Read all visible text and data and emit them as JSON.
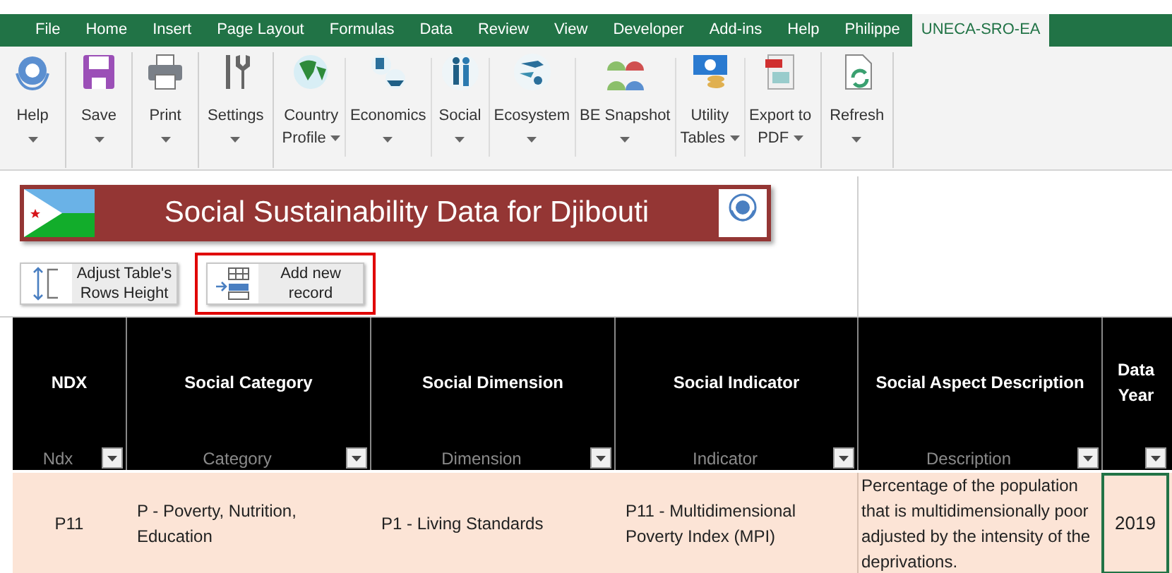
{
  "ribbon_tabs": [
    {
      "label": "File",
      "selected": false
    },
    {
      "label": "Home",
      "selected": false
    },
    {
      "label": "Insert",
      "selected": false
    },
    {
      "label": "Page Layout",
      "selected": false
    },
    {
      "label": "Formulas",
      "selected": false
    },
    {
      "label": "Data",
      "selected": false
    },
    {
      "label": "Review",
      "selected": false
    },
    {
      "label": "View",
      "selected": false
    },
    {
      "label": "Developer",
      "selected": false
    },
    {
      "label": "Add-ins",
      "selected": false
    },
    {
      "label": "Help",
      "selected": false
    },
    {
      "label": "Philippe",
      "selected": false
    },
    {
      "label": "UNECA-SRO-EA",
      "selected": true
    }
  ],
  "ribbon_groups": [
    [
      {
        "lines": [
          "Help"
        ],
        "dropdown": true
      }
    ],
    [
      {
        "lines": [
          "Save"
        ],
        "dropdown": true
      }
    ],
    [
      {
        "lines": [
          "Print"
        ],
        "dropdown": true
      }
    ],
    [
      {
        "lines": [
          "Settings"
        ],
        "dropdown": true
      }
    ],
    [
      {
        "lines": [
          "Country",
          "Profile"
        ],
        "dropdown": true
      },
      {
        "lines": [
          "Economics"
        ],
        "dropdown": true
      },
      {
        "lines": [
          "Social"
        ],
        "dropdown": true
      },
      {
        "lines": [
          "Ecosystem"
        ],
        "dropdown": true
      },
      {
        "lines": [
          "BE Snapshot"
        ],
        "dropdown": true
      },
      {
        "lines": [
          "Utility",
          "Tables"
        ],
        "dropdown": true
      },
      {
        "lines": [
          "Export to",
          "PDF"
        ],
        "dropdown": true
      }
    ],
    [
      {
        "lines": [
          "Refresh"
        ],
        "dropdown": true
      }
    ]
  ],
  "banner": {
    "title": "Social Sustainability Data for Djibouti"
  },
  "sheet_buttons": [
    {
      "label": "Adjust Table's Rows Height",
      "highlighted": false
    },
    {
      "label": "Add new record",
      "highlighted": true
    }
  ],
  "table": {
    "columns": [
      {
        "title": "NDX",
        "filter_label": "Ndx"
      },
      {
        "title": "Social Category",
        "filter_label": "Category"
      },
      {
        "title": "Social Dimension",
        "filter_label": "Dimension"
      },
      {
        "title": "Social Indicator",
        "filter_label": "Indicator"
      },
      {
        "title": "Social Aspect Description",
        "filter_label": "Description"
      },
      {
        "title": "Data Year"
      }
    ],
    "rows": [
      [
        {
          "text": "P11",
          "active": false
        },
        {
          "text": "P - Poverty, Nutrition, Education",
          "active": false
        },
        {
          "text": "P1 - Living Standards",
          "active": false
        },
        {
          "text": "P11 - Multidimensional Poverty Index (MPI)",
          "active": false
        },
        {
          "text": "Percentage of the population that is multidimensionally poor adjusted by the intensity of the deprivations.",
          "active": false
        },
        {
          "text": "2019",
          "active": true
        }
      ]
    ]
  }
}
